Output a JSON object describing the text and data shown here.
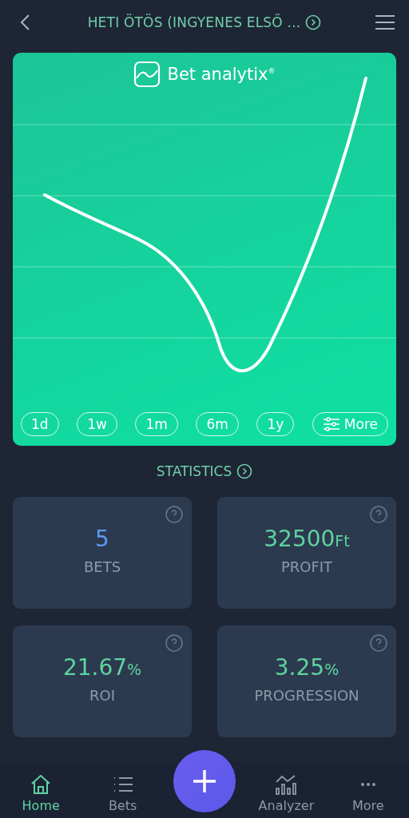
{
  "header": {
    "title": "HETI ÖTÖS (INGYENES ELSŐ ..."
  },
  "chart_card": {
    "logo": "Bet analytix",
    "logo_mark": "®",
    "ranges": [
      {
        "label": "1d",
        "kind": "range"
      },
      {
        "label": "1w",
        "kind": "range"
      },
      {
        "label": "1m",
        "kind": "range"
      },
      {
        "label": "6m",
        "kind": "range"
      },
      {
        "label": "1y",
        "kind": "range"
      },
      {
        "label": "More",
        "kind": "filter"
      }
    ]
  },
  "statistics": {
    "title": "STATISTICS",
    "tiles": [
      {
        "value": "5",
        "label": "BETS",
        "color": "#5b9cf0"
      },
      {
        "value": "32500",
        "unit": "Ft",
        "label": "PROFIT",
        "color": "#5fd3a0"
      },
      {
        "value": "21.67",
        "unit": "%",
        "label": "ROI",
        "color": "#5fd3a0"
      },
      {
        "value": "3.25",
        "unit": "%",
        "label": "PROGRESSION",
        "color": "#5fd3a0"
      }
    ]
  },
  "nav": [
    {
      "kind": "home",
      "label": "Home",
      "selected": true
    },
    {
      "kind": "list",
      "label": "Bets",
      "selected": false
    },
    {
      "kind": "add",
      "selected": false
    },
    {
      "kind": "analyzer",
      "label": "Analyzer",
      "selected": false
    },
    {
      "kind": "more",
      "label": "More",
      "selected": false
    }
  ]
}
